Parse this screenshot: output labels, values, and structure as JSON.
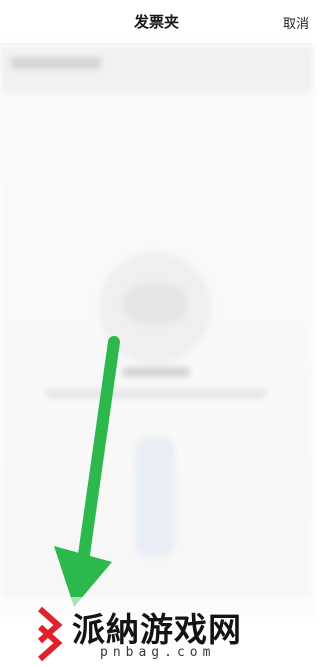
{
  "nav": {
    "title": "发票夹",
    "cancel_label": "取消"
  },
  "watermark": {
    "brand_text": "派納游戏网",
    "url_text": "pnbag.com"
  },
  "colors": {
    "arrow": "#2db84d",
    "watermark_mark": "#e0202a"
  },
  "icons": {
    "arrow": "down-left-arrow",
    "watermark": "pnbag-logo"
  }
}
